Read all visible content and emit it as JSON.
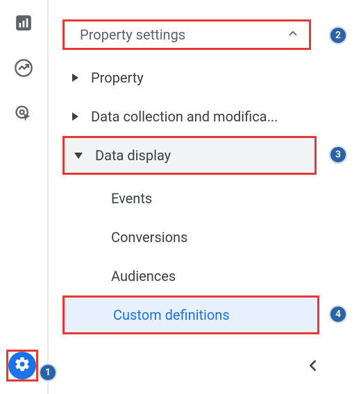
{
  "rail": {
    "icons": [
      "bar-chart-icon",
      "trend-icon",
      "click-icon",
      "gear-icon"
    ]
  },
  "section": {
    "title": "Property settings",
    "items": [
      {
        "label": "Property",
        "expanded": false
      },
      {
        "label": "Data collection and modifica...",
        "expanded": false
      },
      {
        "label": "Data display",
        "expanded": true,
        "children": [
          {
            "label": "Events",
            "active": false
          },
          {
            "label": "Conversions",
            "active": false
          },
          {
            "label": "Audiences",
            "active": false
          },
          {
            "label": "Custom definitions",
            "active": true
          }
        ]
      }
    ]
  },
  "annotations": {
    "steps": [
      "1",
      "2",
      "3",
      "4"
    ],
    "highlight_color": "#e53935",
    "badge_color": "#2962a8",
    "active_color": "#1a73e8"
  }
}
